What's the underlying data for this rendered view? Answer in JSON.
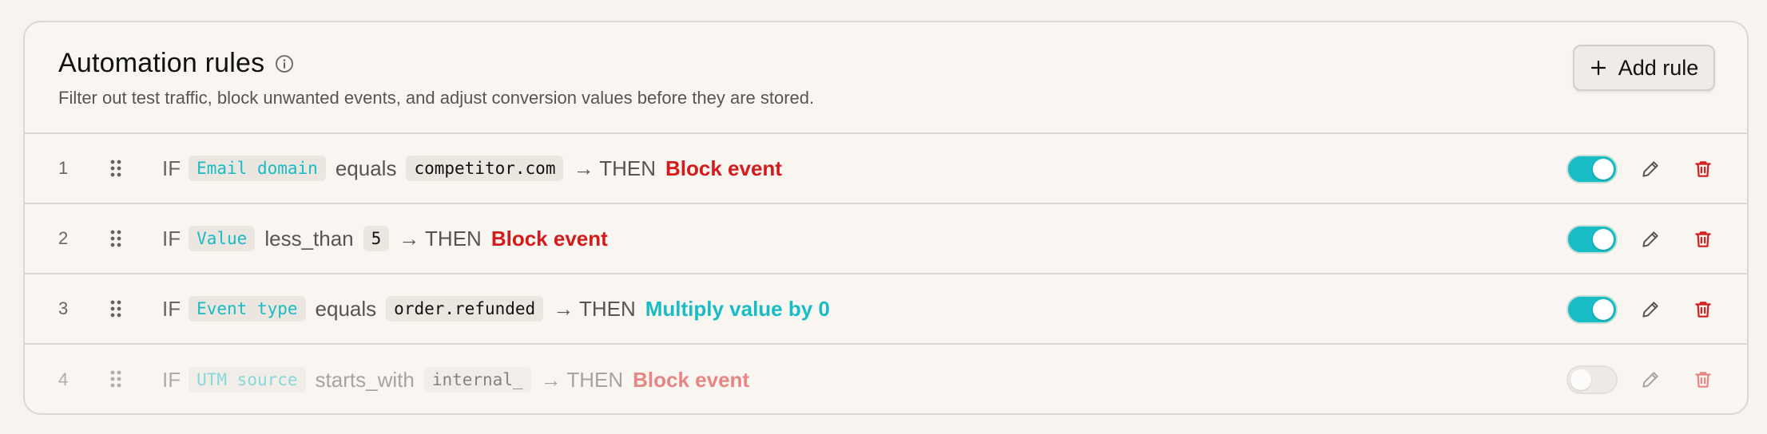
{
  "header": {
    "title": "Automation rules",
    "subtitle": "Filter out test traffic, block unwanted events, and adjust conversion values before they are stored.",
    "add_rule_label": "Add rule"
  },
  "colors": {
    "accent": "#17bcc4",
    "danger": "#d41a1a",
    "background": "#f9f5f1"
  },
  "rules": [
    {
      "number": "1",
      "if_label": "IF",
      "field": "Email domain",
      "operator": "equals",
      "value": "competitor.com",
      "then_label": "→ THEN",
      "action": "Block event",
      "enabled": true
    },
    {
      "number": "2",
      "if_label": "IF",
      "field": "Value",
      "operator": "less_than",
      "value": "5",
      "then_label": "→ THEN",
      "action": "Block event",
      "enabled": true
    },
    {
      "number": "3",
      "if_label": "IF",
      "field": "Event type",
      "operator": "equals",
      "value": "order.refunded",
      "then_label": "→ THEN",
      "action": "Multiply value by 0",
      "enabled": true
    },
    {
      "number": "4",
      "if_label": "IF",
      "field": "UTM source",
      "operator": "starts_with",
      "value": "internal_",
      "then_label": "→ THEN",
      "action": "Block event",
      "enabled": false
    }
  ],
  "icons": {
    "info": "info-icon",
    "add": "plus-icon",
    "drag": "drag-handle-icon",
    "edit": "pencil-icon",
    "delete": "trash-icon"
  }
}
